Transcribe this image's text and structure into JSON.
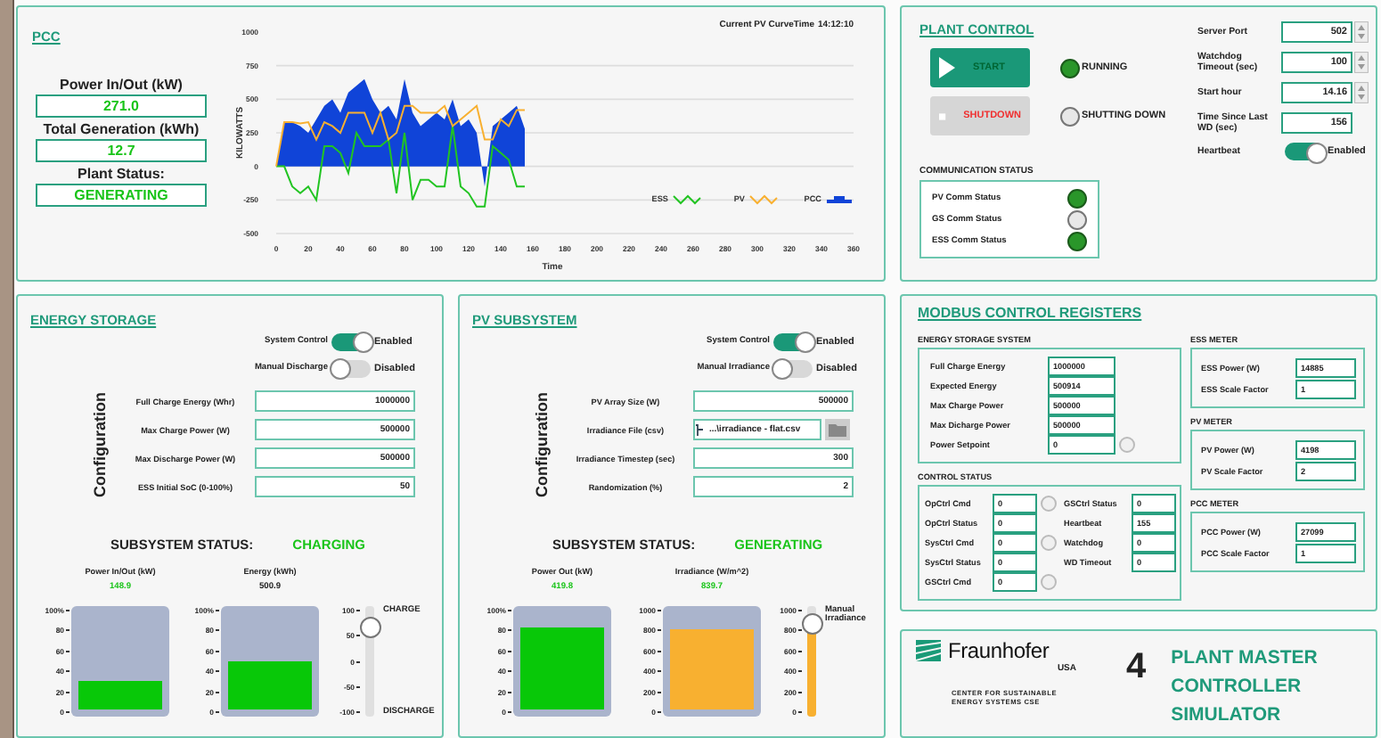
{
  "pcc": {
    "title": "PCC",
    "power_label": "Power In/Out (kW)",
    "power": "271.0",
    "generation_label": "Total Generation (kWh)",
    "generation": "12.7",
    "status_label": "Plant Status:",
    "status": "GENERATING",
    "curve_time_label": "Current PV CurveTime",
    "curve_time": "14:12:10",
    "chart_data": {
      "type": "line",
      "grid": true,
      "legend": "lower right",
      "xlabel": "Time",
      "ylabel": "KILOWATTS",
      "xlim": [
        0,
        360
      ],
      "ylim": [
        -500,
        1000
      ],
      "xticks": [
        0,
        20,
        40,
        60,
        80,
        100,
        120,
        140,
        160,
        180,
        200,
        220,
        240,
        260,
        280,
        300,
        320,
        340,
        360
      ],
      "yticks": [
        -500,
        -250,
        0,
        250,
        500,
        750,
        1000
      ],
      "x": [
        0,
        5,
        10,
        15,
        20,
        25,
        30,
        35,
        40,
        45,
        50,
        55,
        60,
        65,
        70,
        75,
        80,
        85,
        90,
        95,
        100,
        105,
        110,
        115,
        120,
        125,
        130,
        135,
        140,
        145,
        150,
        155
      ],
      "series": [
        {
          "name": "ESS",
          "color": "#22c422",
          "values": [
            0,
            0,
            -150,
            -200,
            -150,
            -250,
            150,
            150,
            100,
            -50,
            250,
            150,
            150,
            150,
            200,
            -200,
            250,
            -250,
            -100,
            -100,
            -150,
            -150,
            300,
            -150,
            -200,
            -300,
            -300,
            150,
            100,
            50,
            -150,
            -150
          ]
        },
        {
          "name": "PV",
          "color": "#f8b030",
          "values": [
            0,
            330,
            330,
            320,
            330,
            200,
            330,
            300,
            250,
            400,
            400,
            400,
            250,
            400,
            200,
            250,
            450,
            450,
            400,
            400,
            400,
            450,
            300,
            350,
            400,
            450,
            200,
            200,
            350,
            300,
            420,
            420
          ]
        },
        {
          "name": "PCC",
          "color": "#1044d8",
          "type": "area",
          "values": [
            0,
            330,
            330,
            300,
            250,
            350,
            450,
            500,
            400,
            550,
            600,
            650,
            500,
            400,
            450,
            350,
            650,
            400,
            300,
            350,
            400,
            350,
            500,
            300,
            350,
            250,
            -150,
            300,
            350,
            400,
            450,
            280
          ]
        }
      ]
    }
  },
  "plant_control": {
    "title": "PLANT CONTROL",
    "start": "START",
    "shutdown": "SHUTDOWN",
    "indicators": [
      {
        "label": "RUNNING",
        "on": true
      },
      {
        "label": "SHUTTING DOWN",
        "on": false
      }
    ],
    "settings": [
      {
        "label": "Server Port",
        "value": "502",
        "kind": "spinner"
      },
      {
        "label": "Watchdog Timeout (sec)",
        "value": "100",
        "kind": "spinner"
      },
      {
        "label": "Start hour",
        "value": "14.16",
        "kind": "spinner"
      },
      {
        "label": "Time Since Last WD (sec)",
        "value": "156",
        "kind": "readout"
      }
    ],
    "heartbeat": {
      "label": "Heartbeat",
      "on": true,
      "state": "Enabled"
    },
    "comm_title": "COMMUNICATION STATUS",
    "comm": [
      {
        "label": "PV Comm Status",
        "on": true
      },
      {
        "label": "GS Comm Status",
        "on": false
      },
      {
        "label": "ESS Comm Status",
        "on": true
      }
    ]
  },
  "energy_storage": {
    "title": "ENERGY STORAGE",
    "switches": [
      {
        "label": "System Control",
        "on": true,
        "state": "Enabled"
      },
      {
        "label": "Manual  Discharge",
        "on": false,
        "state": "Disabled"
      }
    ],
    "config_title": "Configuration",
    "config": [
      {
        "label": "Full Charge Energy (Whr)",
        "value": "1000000"
      },
      {
        "label": "Max Charge Power (W)",
        "value": "500000"
      },
      {
        "label": "Max Discharge Power (W)",
        "value": "500000"
      },
      {
        "label": "ESS Initial SoC (0-100%)",
        "value": "50"
      }
    ],
    "status_label": "SUBSYSTEM STATUS:",
    "status": "CHARGING",
    "gauges": [
      {
        "label": "Power In/Out (kW)",
        "reading": "148.9",
        "active": true,
        "color": "#08c808",
        "level": 0.3,
        "ticks": [
          "100%",
          "80",
          "60",
          "40",
          "20",
          "0"
        ]
      },
      {
        "label": "Energy (kWh)",
        "reading": "500.9",
        "active": false,
        "color": "#08c808",
        "level": 0.5,
        "ticks": [
          "100%",
          "80",
          "60",
          "40",
          "20",
          "0"
        ]
      }
    ],
    "slider": {
      "filled": false,
      "level": 0.8,
      "ticks": [
        "100",
        "50",
        "0",
        "-50",
        "-100"
      ],
      "top_label": "CHARGE",
      "bottom_label": "DISCHARGE"
    }
  },
  "pv_subsystem": {
    "title": "PV SUBSYSTEM",
    "switches": [
      {
        "label": "System Control",
        "on": true,
        "state": "Enabled"
      },
      {
        "label": "Manual Irradiance",
        "on": false,
        "state": "Disabled"
      }
    ],
    "config_title": "Configuration",
    "config": [
      {
        "label": "PV Array Size (W)",
        "value": "500000"
      },
      {
        "label": "Irradiance File (csv)",
        "value": "...\\irradiance - flat.csv",
        "kind": "file"
      },
      {
        "label": "Irradiance Timestep (sec)",
        "value": "300"
      },
      {
        "label": "Randomization (%)",
        "value": "2"
      }
    ],
    "status_label": "SUBSYSTEM STATUS:",
    "status": "GENERATING",
    "gauges": [
      {
        "label": "Power Out (kW)",
        "reading": "419.8",
        "active": true,
        "color": "#08c808",
        "level": 0.85,
        "ticks": [
          "100%",
          "80",
          "60",
          "40",
          "20",
          "0"
        ]
      },
      {
        "label": "Irradiance (W/m^2)",
        "reading": "839.7",
        "active": true,
        "color": "#f8b030",
        "level": 0.84,
        "ticks": [
          "1000",
          "800",
          "600",
          "400",
          "200",
          "0"
        ]
      }
    ],
    "slider": {
      "filled": true,
      "level": 0.84,
      "ticks": [
        "1000",
        "800",
        "600",
        "400",
        "200",
        "0"
      ],
      "top_label": "Manual Irradiance"
    }
  },
  "modbus": {
    "title": "MODBUS CONTROL REGISTERS",
    "ess_title": "ENERGY STORAGE SYSTEM",
    "ess": [
      {
        "label": "Full Charge Energy",
        "value": "1000000",
        "kind": "value"
      },
      {
        "label": "Expected Energy",
        "value": "500914",
        "kind": "value"
      },
      {
        "label": "Max Charge Power",
        "value": "500000",
        "kind": "value"
      },
      {
        "label": "Max Dicharge Power",
        "value": "500000",
        "kind": "value"
      },
      {
        "label": "Power Setpoint",
        "value": "0",
        "kind": "led",
        "on": false
      }
    ],
    "control_title": "CONTROL STATUS",
    "control_left": [
      {
        "label": "OpCtrl Cmd",
        "value": "0",
        "kind": "led",
        "on": false
      },
      {
        "label": "OpCtrl Status",
        "value": "0",
        "kind": "value"
      },
      {
        "label": "SysCtrl Cmd",
        "value": "0",
        "kind": "led",
        "on": false
      },
      {
        "label": "SysCtrl Status",
        "value": "0",
        "kind": "value"
      },
      {
        "label": "GSCtrl Cmd",
        "value": "0",
        "kind": "led",
        "on": false
      }
    ],
    "control_right": [
      {
        "label": "GSCtrl Status",
        "value": "0"
      },
      {
        "label": "Heartbeat",
        "value": "155"
      },
      {
        "label": "Watchdog",
        "value": "0"
      },
      {
        "label": "WD Timeout",
        "value": "0"
      }
    ],
    "meters": [
      {
        "title": "ESS METER",
        "rows": [
          {
            "label": "ESS Power (W)",
            "value": "14885"
          },
          {
            "label": "ESS Scale Factor",
            "value": "1"
          }
        ]
      },
      {
        "title": "PV METER",
        "rows": [
          {
            "label": "PV Power (W)",
            "value": "4198"
          },
          {
            "label": "PV Scale Factor",
            "value": "2"
          }
        ]
      },
      {
        "title": "PCC METER",
        "rows": [
          {
            "label": "PCC Power (W)",
            "value": "27099"
          },
          {
            "label": "PCC Scale Factor",
            "value": "1"
          }
        ]
      }
    ]
  },
  "footer": {
    "logo": "Fraunhofer",
    "logo_sub": "USA",
    "caption": "CENTER FOR SUSTAINABLE ENERGY SYSTEMS CSE",
    "number": "4",
    "title": "PLANT MASTER CONTROLLER SIMULATOR"
  }
}
